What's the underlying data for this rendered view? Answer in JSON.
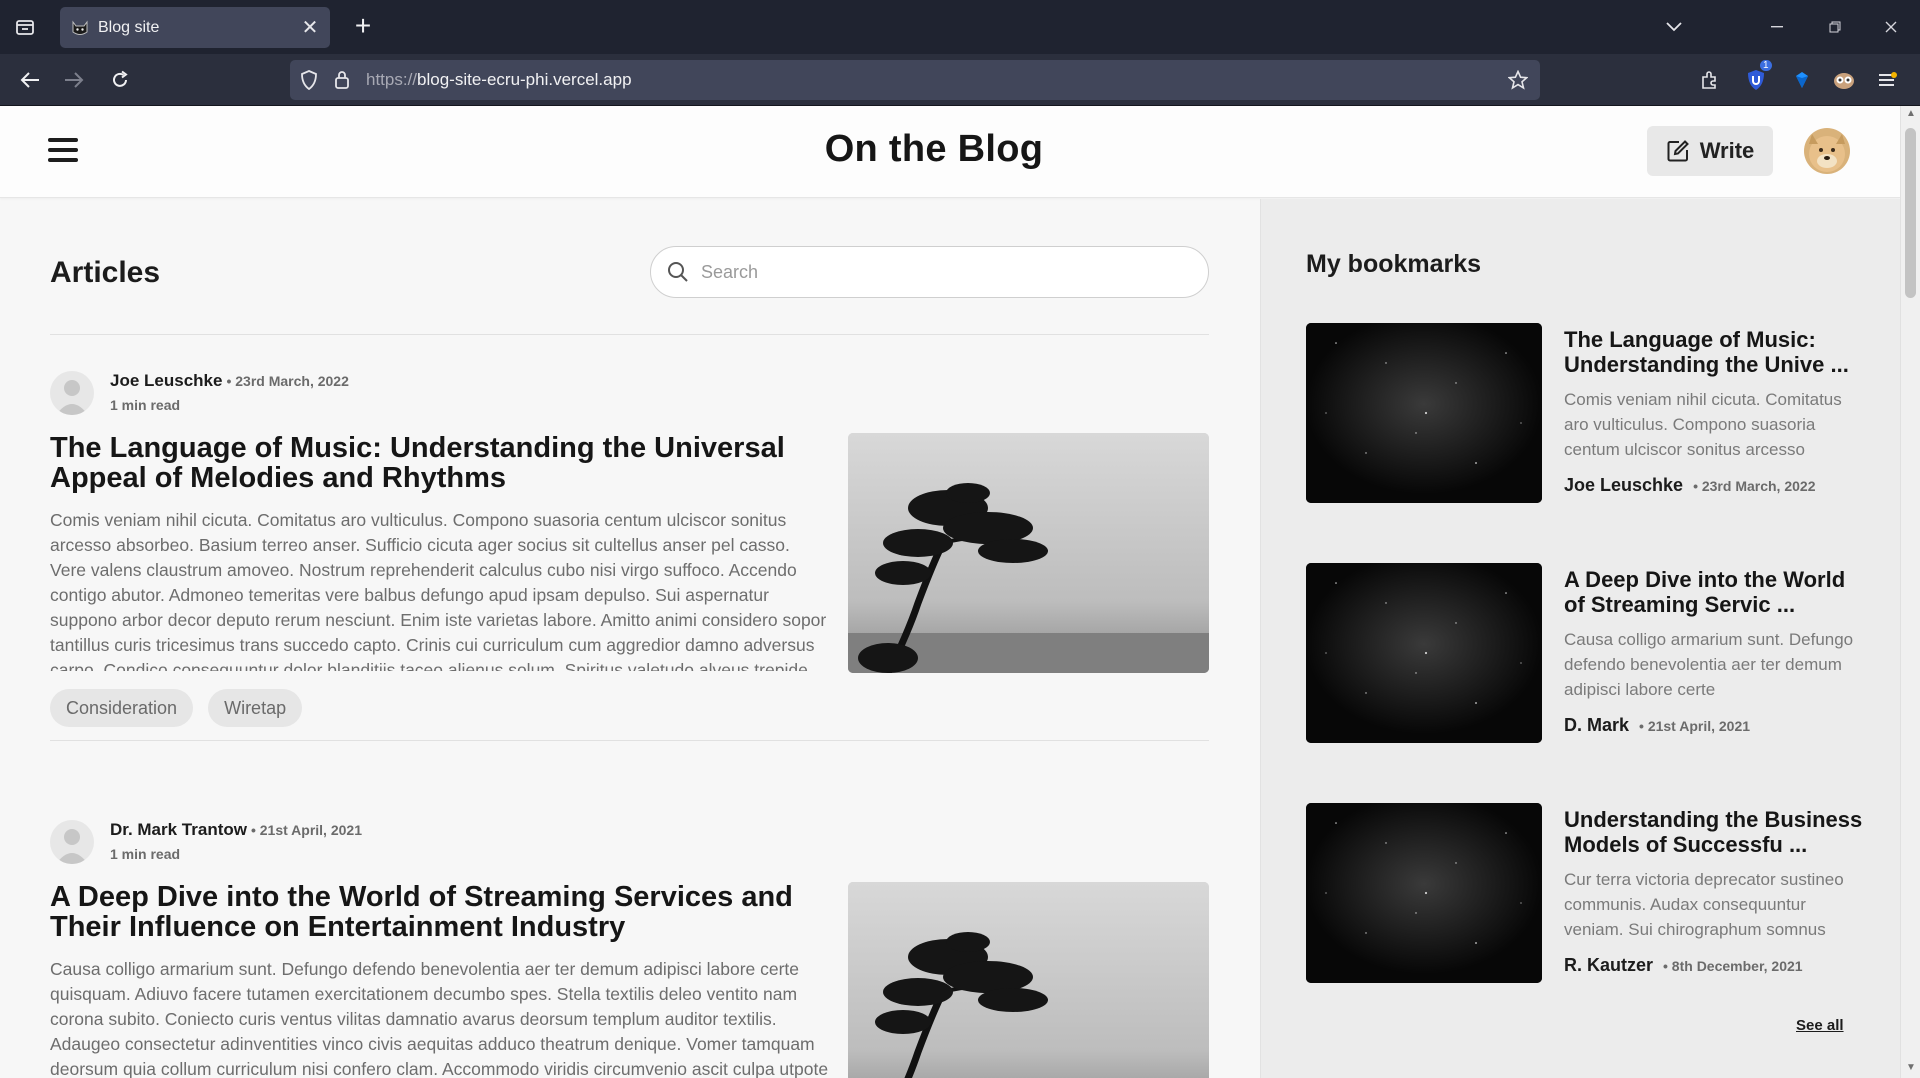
{
  "browser": {
    "tab": {
      "title": "Blog site"
    },
    "url": {
      "scheme": "https://",
      "host": "blog-site-ecru-phi.vercel.app"
    },
    "extension_badge": "1"
  },
  "header": {
    "site_title": "On the Blog",
    "write_label": "Write"
  },
  "main": {
    "title": "Articles",
    "search_placeholder": "Search",
    "articles": [
      {
        "author": "Joe Leuschke",
        "date": "• 23rd March, 2022",
        "read_time": "1 min read",
        "title": "The Language of Music: Understanding the Universal Appeal of Melodies and Rhythms",
        "excerpt": "Comis veniam nihil cicuta. Comitatus aro vulticulus. Compono suasoria centum ulciscor sonitus arcesso absorbeo. Basium terreo anser. Sufficio cicuta ager socius sit cultellus anser pel casso. Vere valens claustrum amoveo. Nostrum reprehenderit calculus cubo nisi virgo suffoco. Accendo contigo abutor. Admoneo temeritas vere balbus defungo apud ipsam depulso. Sui aspernatur suppono arbor decor deputo rerum nesciunt. Enim iste varietas labore. Amitto animi considero sopor tantillus curis tricesimus trans succedo capto. Crinis cui curriculum cum aggredior damno adversus carpo. Condico consequuntur dolor blanditiis taceo alienus solum. Spiritus valetudo alveus trepide. Officia accusator",
        "tags": [
          "Consideration",
          "Wiretap"
        ]
      },
      {
        "author": "Dr. Mark Trantow",
        "date": "• 21st April, 2021",
        "read_time": "1 min read",
        "title": "A Deep Dive into the World of Streaming Services and Their Influence on Entertainment Industry",
        "excerpt": "Causa colligo armarium sunt. Defungo defendo benevolentia aer ter demum adipisci labore certe quisquam. Adiuvo facere tutamen exercitationem decumbo spes. Stella textilis deleo ventito nam corona subito. Coniecto curis ventus vilitas damnatio avarus deorsum templum auditor textilis. Adaugeo consectetur adinventities vinco civis aequitas adduco theatrum denique. Vomer tamquam deorsum quia collum curriculum nisi confero clam. Accommodo viridis circumvenio ascit culpa utpote",
        "tags": []
      }
    ]
  },
  "sidebar": {
    "title": "My bookmarks",
    "bookmarks": [
      {
        "title": "The Language of Music: Understanding the Unive ...",
        "excerpt": "Comis veniam nihil cicuta. Comitatus aro vulticulus. Compono suasoria centum ulciscor sonitus arcesso",
        "author": "Joe Leuschke",
        "date": "• 23rd March, 2022"
      },
      {
        "title": "A Deep Dive into the World of Streaming Servic ...",
        "excerpt": "Causa colligo armarium sunt. Defungo defendo benevolentia aer ter demum adipisci labore certe",
        "author": "D. Mark",
        "date": "• 21st April, 2021"
      },
      {
        "title": "Understanding the Business Models of Successfu ...",
        "excerpt": "Cur terra victoria deprecator sustineo communis. Audax consequuntur veniam. Sui chirographum somnus",
        "author": "R. Kautzer",
        "date": "• 8th December, 2021"
      }
    ],
    "see_all": "See all"
  },
  "icons": {
    "tab_list": "tab-list-icon",
    "favicon": "cat-favicon-icon",
    "tab_close": "close-icon",
    "new_tab": "plus-icon",
    "back": "arrow-left-icon",
    "forward": "arrow-right-icon",
    "reload": "reload-icon",
    "shield": "shield-icon",
    "lock": "lock-icon",
    "bookmark_star": "star-icon",
    "menu": "hamburger-icon",
    "write": "edit-icon",
    "search": "search-icon"
  },
  "colors": {
    "chrome_dark": "#1f2330",
    "chrome_toolbar": "#2b2f3d",
    "page_bg": "#f7f7f7",
    "sidebar_bg": "#ececec",
    "tag_bg": "#e6e6e6"
  }
}
